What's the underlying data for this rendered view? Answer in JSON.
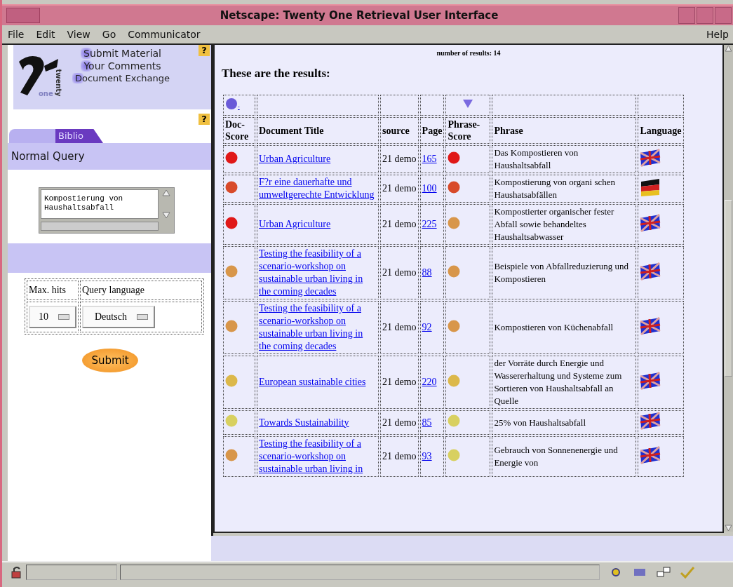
{
  "window": {
    "title": "Netscape: Twenty One Retrieval User Interface"
  },
  "menu": [
    {
      "label": "File"
    },
    {
      "label": "Edit"
    },
    {
      "label": "View"
    },
    {
      "label": "Go"
    },
    {
      "label": "Communicator"
    }
  ],
  "help_menu": "Help",
  "sidebar": {
    "logo": {
      "small_word": "one",
      "vertical_word": "twenty"
    },
    "links": [
      "Submit Material",
      "Your Comments",
      "Document Exchange"
    ],
    "help_marks": [
      "?",
      "?"
    ],
    "tabs": [
      {
        "selected": false
      },
      {
        "label": "Biblio",
        "selected": true
      }
    ],
    "section_title": "Normal Query",
    "query": {
      "value": "Kompostierung von\nHaushaltsabfall"
    },
    "options": {
      "headers": [
        "Max. hits",
        "Query language"
      ],
      "max_hits": "10",
      "language": "Deutsch"
    },
    "submit": "Submit"
  },
  "results": {
    "count": "number of results: 14",
    "heading": "These are the results:",
    "sort_mark": "-",
    "columns": [
      "Doc-Score",
      "Document Title",
      "source",
      "Page",
      "Phrase-Score",
      "Phrase",
      "Language"
    ],
    "rows": [
      {
        "doc_score": {
          "color": "#e01818"
        },
        "title": "Urban Agriculture",
        "source": "21 demo",
        "page": "165",
        "phrase_score": {
          "color": "#e01818"
        },
        "phrase": "Das Kompostieren von Haushaltsabfall",
        "flag": {
          "kind": "uk"
        }
      },
      {
        "doc_score": {
          "color": "#d84a2a"
        },
        "title": "F?r eine dauerhafte und umweltgerechte Entwicklung",
        "source": "21 demo",
        "page": "100",
        "phrase_score": {
          "color": "#d84a2a"
        },
        "phrase": "Kompostierung von organi schen Haushatsabfällen",
        "flag": {
          "kind": "de"
        }
      },
      {
        "doc_score": {
          "color": "#e01818"
        },
        "title": "Urban Agriculture",
        "source": "21 demo",
        "page": "225",
        "phrase_score": {
          "color": "#d8964a"
        },
        "phrase": "Kompostierter organischer fester Abfall sowie behandeltes Haushaltsabwasser",
        "flag": {
          "kind": "uk"
        }
      },
      {
        "doc_score": {
          "color": "#d8964a"
        },
        "title": "Testing the feasibility of a scenario-workshop on sustainable urban living in the coming decades",
        "source": "21 demo",
        "page": "88",
        "phrase_score": {
          "color": "#d8964a"
        },
        "phrase": "Beispiele von Abfallreduzierung und Kompostieren",
        "flag": {
          "kind": "uk"
        }
      },
      {
        "doc_score": {
          "color": "#d8964a"
        },
        "title": "Testing the feasibility of a scenario-workshop on sustainable urban living in the coming decades",
        "source": "21 demo",
        "page": "92",
        "phrase_score": {
          "color": "#d8964a"
        },
        "phrase": "Kompostieren von Küchenabfall",
        "flag": {
          "kind": "uk"
        }
      },
      {
        "doc_score": {
          "color": "#dcb84a"
        },
        "title": "European sustainable cities",
        "source": "21 demo",
        "page": "220",
        "phrase_score": {
          "color": "#dcb84a"
        },
        "phrase": "der Vorräte durch Energie und Wassererhaltung und Systeme zum Sortieren von Haushaltsabfall an Quelle",
        "flag": {
          "kind": "uk"
        }
      },
      {
        "doc_score": {
          "color": "#d8d060"
        },
        "title": "Towards Sustainability",
        "source": "21 demo",
        "page": "85",
        "phrase_score": {
          "color": "#d8d060"
        },
        "phrase": "25% von Haushaltsabfall",
        "flag": {
          "kind": "uk"
        }
      },
      {
        "doc_score": {
          "color": "#d8964a"
        },
        "title": "Testing the feasibility of a scenario-workshop on sustainable urban living in",
        "source": "21 demo",
        "page": "93",
        "phrase_score": {
          "color": "#d8d060"
        },
        "phrase": "Gebrauch von Sonnenenergie und Energie von",
        "flag": {
          "kind": "uk"
        }
      }
    ]
  }
}
